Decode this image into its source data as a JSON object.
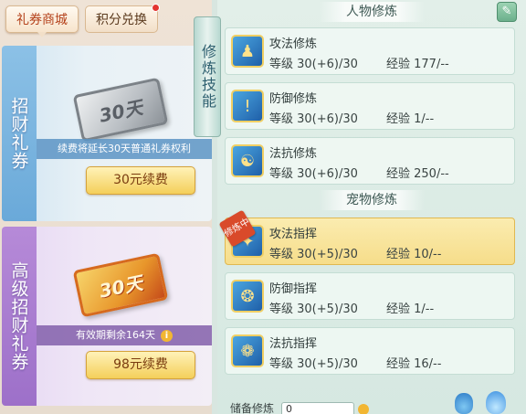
{
  "tabs": [
    {
      "label": "礼券商城",
      "active": true
    },
    {
      "label": "积分兑换",
      "active": false,
      "notification_dot": true
    }
  ],
  "cards": [
    {
      "side_label": "招财礼券",
      "ticket_text": "30天",
      "description": "续费将延长30天普通礼券权利",
      "button_label": "30元续费"
    },
    {
      "side_label": "高级招财礼券",
      "ticket_text": "30天",
      "description": "有效期剩余164天",
      "button_label": "98元续费"
    }
  ],
  "skill_ribbon": "修炼技能",
  "character_section": {
    "title": "人物修炼",
    "skills": [
      {
        "name": "攻法修炼",
        "level": "等级  30(+6)/30",
        "exp": "经验  177/--",
        "icon": "attack-magic-icon"
      },
      {
        "name": "防御修炼",
        "level": "等级  30(+6)/30",
        "exp": "经验  1/--",
        "icon": "defense-icon"
      },
      {
        "name": "法抗修炼",
        "level": "等级  30(+6)/30",
        "exp": "经验  250/--",
        "icon": "magic-resist-icon"
      }
    ]
  },
  "pet_section": {
    "title": "宠物修炼",
    "skills": [
      {
        "name": "攻法指挥",
        "level": "等级  30(+5)/30",
        "exp": "经验  10/--",
        "icon": "pet-attack-icon",
        "training": true,
        "badge": "修炼中"
      },
      {
        "name": "防御指挥",
        "level": "等级  30(+5)/30",
        "exp": "经验  1/--",
        "icon": "pet-defense-icon"
      },
      {
        "name": "法抗指挥",
        "level": "等级  30(+5)/30",
        "exp": "经验  16/--",
        "icon": "pet-resist-icon"
      }
    ]
  },
  "storage": {
    "label": "储备修炼",
    "value": "0"
  },
  "colors": {
    "accent_gold": "#f4cf5a",
    "active_row": "#f6dd8a",
    "panel_bg": "#e2efe9"
  }
}
